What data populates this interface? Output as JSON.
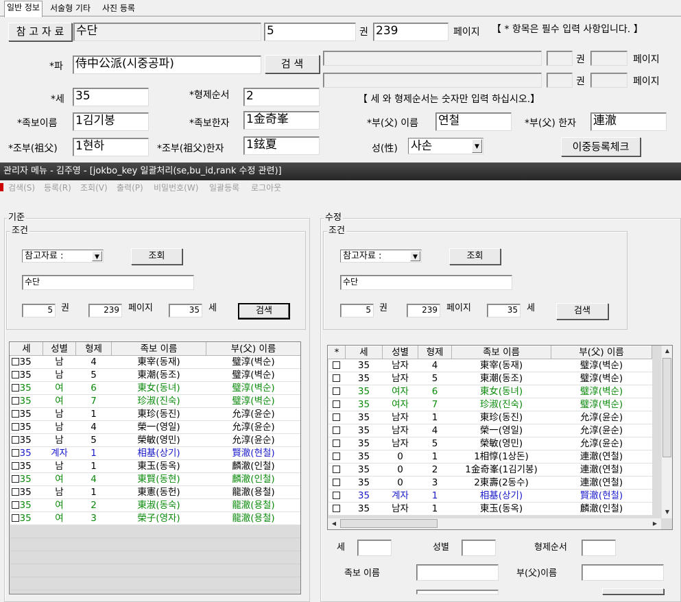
{
  "tabs": [
    {
      "label": "일반 정보"
    },
    {
      "label": "서술형 기타"
    },
    {
      "label": "사진 등록"
    }
  ],
  "top_form": {
    "ref_button": "참 고 자 료",
    "ref_value": "수단",
    "vol_value": "5",
    "vol_label": "권",
    "page_value": "239",
    "page_label": "페이지",
    "required_note": "【 * 항목은 필수 입력 사항입니다. 】",
    "pa_label": "*파",
    "pa_value": "侍中公派(시중공파)",
    "search_button": "검 색",
    "extra_vol_label_1": "권",
    "extra_page_label_1": "페이지",
    "extra_vol_label_2": "권",
    "extra_page_label_2": "페이지",
    "se_label": "*세",
    "se_value": "35",
    "order_label": "*형제순서",
    "order_value": "2",
    "numbers_note": "【 세 와 형제순서는 숫자만 입력 하십시오.】",
    "name_label": "*족보이름",
    "name_value": "1김기봉",
    "hanja_label": "*족보한자",
    "hanja_value": "1金奇峯",
    "father_name_label": "*부(父) 이름",
    "father_name_value": "연철",
    "father_hanja_label": "*부(父) 한자",
    "father_hanja_value": "連澈",
    "grandfather_label": "*조부(祖父)",
    "grandfather_value": "1현하",
    "grandfather_hanja_label": "*조부(祖父)한자",
    "grandfather_hanja_value": "1鉉夏",
    "gender_label": "성(性)",
    "gender_value": "사손",
    "dup_check_button": "이중등록체크"
  },
  "window": {
    "title": "관리자 메뉴 - 김주영 - [jokbo_key 일괄처리(se,bu_id,rank 수정 관련)]"
  },
  "menu": [
    {
      "label": "검색(S)"
    },
    {
      "label": "등록(R)"
    },
    {
      "label": "조회(V)"
    },
    {
      "label": "출력(P)"
    },
    {
      "label": "비밀번호(W)"
    },
    {
      "label": "일괄등록"
    },
    {
      "label": "로그아웃"
    }
  ],
  "left_panel": {
    "group_label": "기준",
    "condition_label": "조건",
    "combo_value": "참고자료 :",
    "query_button": "조회",
    "ref_value": "수단",
    "vol_value": "5",
    "vol_label": "권",
    "page_value": "239",
    "page_label": "페이지",
    "se_value": "35",
    "se_label": "세",
    "search_button": "검색",
    "columns": [
      "세",
      "성별",
      "형제",
      "족보 이름",
      "부(父) 이름"
    ],
    "rows": [
      {
        "se": "35",
        "gender": "남",
        "order": "4",
        "name": "東宰(동재)",
        "father": "璧淳(벽순)",
        "color": "black"
      },
      {
        "se": "35",
        "gender": "남",
        "order": "5",
        "name": "東潮(동조)",
        "father": "璧淳(벽순)",
        "color": "black"
      },
      {
        "se": "35",
        "gender": "여",
        "order": "6",
        "name": "東女(동녀)",
        "father": "璧淳(벽순)",
        "color": "green"
      },
      {
        "se": "35",
        "gender": "여",
        "order": "7",
        "name": "珍淑(진숙)",
        "father": "璧淳(벽순)",
        "color": "green"
      },
      {
        "se": "35",
        "gender": "남",
        "order": "1",
        "name": "東珍(동진)",
        "father": "允淳(윤순)",
        "color": "black"
      },
      {
        "se": "35",
        "gender": "남",
        "order": "4",
        "name": "榮一(영일)",
        "father": "允淳(윤순)",
        "color": "black"
      },
      {
        "se": "35",
        "gender": "남",
        "order": "5",
        "name": "榮敏(영민)",
        "father": "允淳(윤순)",
        "color": "black"
      },
      {
        "se": "35",
        "gender": "계자",
        "order": "1",
        "name": "相基(상기)",
        "father": "賢澈(현철)",
        "color": "blue"
      },
      {
        "se": "35",
        "gender": "남",
        "order": "1",
        "name": "東玉(동옥)",
        "father": "麟澈(인철)",
        "color": "black"
      },
      {
        "se": "35",
        "gender": "여",
        "order": "4",
        "name": "東賢(동현)",
        "father": "麟澈(인철)",
        "color": "green"
      },
      {
        "se": "35",
        "gender": "남",
        "order": "1",
        "name": "東憲(동헌)",
        "father": "龍澈(용철)",
        "color": "black"
      },
      {
        "se": "35",
        "gender": "여",
        "order": "2",
        "name": "東淑(동숙)",
        "father": "龍澈(용철)",
        "color": "green"
      },
      {
        "se": "35",
        "gender": "여",
        "order": "3",
        "name": "榮子(영자)",
        "father": "龍澈(용철)",
        "color": "green"
      }
    ]
  },
  "right_panel": {
    "group_label": "수정",
    "condition_label": "조건",
    "combo_value": "참고자료 :",
    "query_button": "조회",
    "ref_value": "수단",
    "vol_value": "5",
    "vol_label": "권",
    "page_value": "239",
    "page_label": "페이지",
    "se_value": "35",
    "se_label": "세",
    "search_button": "검색",
    "columns": [
      "*",
      "세",
      "성별",
      "형제",
      "족보 이름",
      "부(父) 이름"
    ],
    "rows": [
      {
        "se": "35",
        "gender": "남자",
        "order": "4",
        "name": "東宰(동재)",
        "father": "璧淳(벽순)",
        "color": "black"
      },
      {
        "se": "35",
        "gender": "남자",
        "order": "5",
        "name": "東潮(동조)",
        "father": "璧淳(벽순)",
        "color": "black"
      },
      {
        "se": "35",
        "gender": "여자",
        "order": "6",
        "name": "東女(동녀)",
        "father": "璧淳(벽순)",
        "color": "green"
      },
      {
        "se": "35",
        "gender": "여자",
        "order": "7",
        "name": "珍淑(진숙)",
        "father": "璧淳(벽순)",
        "color": "green"
      },
      {
        "se": "35",
        "gender": "남자",
        "order": "1",
        "name": "東珍(동진)",
        "father": "允淳(윤순)",
        "color": "black"
      },
      {
        "se": "35",
        "gender": "남자",
        "order": "4",
        "name": "榮一(영일)",
        "father": "允淳(윤순)",
        "color": "black"
      },
      {
        "se": "35",
        "gender": "남자",
        "order": "5",
        "name": "榮敏(영민)",
        "father": "允淳(윤순)",
        "color": "black"
      },
      {
        "se": "35",
        "gender": "0",
        "order": "1",
        "name": "1相惇(1상돈)",
        "father": "連澈(연철)",
        "color": "black"
      },
      {
        "se": "35",
        "gender": "0",
        "order": "2",
        "name": "1金奇峯(1김기봉)",
        "father": "連澈(연철)",
        "color": "black"
      },
      {
        "se": "35",
        "gender": "0",
        "order": "3",
        "name": "2東壽(2동수)",
        "father": "連澈(연철)",
        "color": "black"
      },
      {
        "se": "35",
        "gender": "계자",
        "order": "1",
        "name": "相基(상기)",
        "father": "賢澈(현철)",
        "color": "blue"
      },
      {
        "se": "35",
        "gender": "남자",
        "order": "1",
        "name": "東玉(동옥)",
        "father": "麟澈(인철)",
        "color": "black"
      }
    ],
    "edit_se_label": "세",
    "edit_gender_label": "성별",
    "edit_order_label": "형제순서",
    "edit_name_label": "족보 이름",
    "edit_father_label": "부(父)이름"
  }
}
